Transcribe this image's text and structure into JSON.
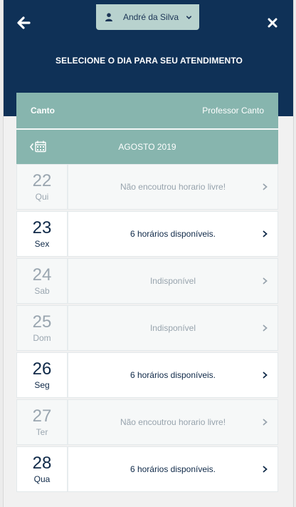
{
  "header": {
    "user_name": "André da Silva",
    "title": "SELECIONE O DIA PARA SEU ATENDIMENTO"
  },
  "service": {
    "name": "Canto",
    "professional": "Professor Canto"
  },
  "calendar": {
    "month_label": "AGOSTO 2019"
  },
  "days": [
    {
      "day": "22",
      "weekday": "Qui",
      "message": "Não encoutrou horario livre!",
      "available": false
    },
    {
      "day": "23",
      "weekday": "Sex",
      "message": "6 horários disponíveis.",
      "available": true
    },
    {
      "day": "24",
      "weekday": "Sab",
      "message": "Indisponível",
      "available": false
    },
    {
      "day": "25",
      "weekday": "Dom",
      "message": "Indisponível",
      "available": false
    },
    {
      "day": "26",
      "weekday": "Seg",
      "message": "6 horários disponíveis.",
      "available": true
    },
    {
      "day": "27",
      "weekday": "Ter",
      "message": "Não encoutrou horario livre!",
      "available": false
    },
    {
      "day": "28",
      "weekday": "Qua",
      "message": "6 horários disponíveis.",
      "available": true
    }
  ],
  "colors": {
    "header_bg": "#0f3157",
    "accent": "#87b5ae",
    "user_pill": "#b8d2ce"
  }
}
